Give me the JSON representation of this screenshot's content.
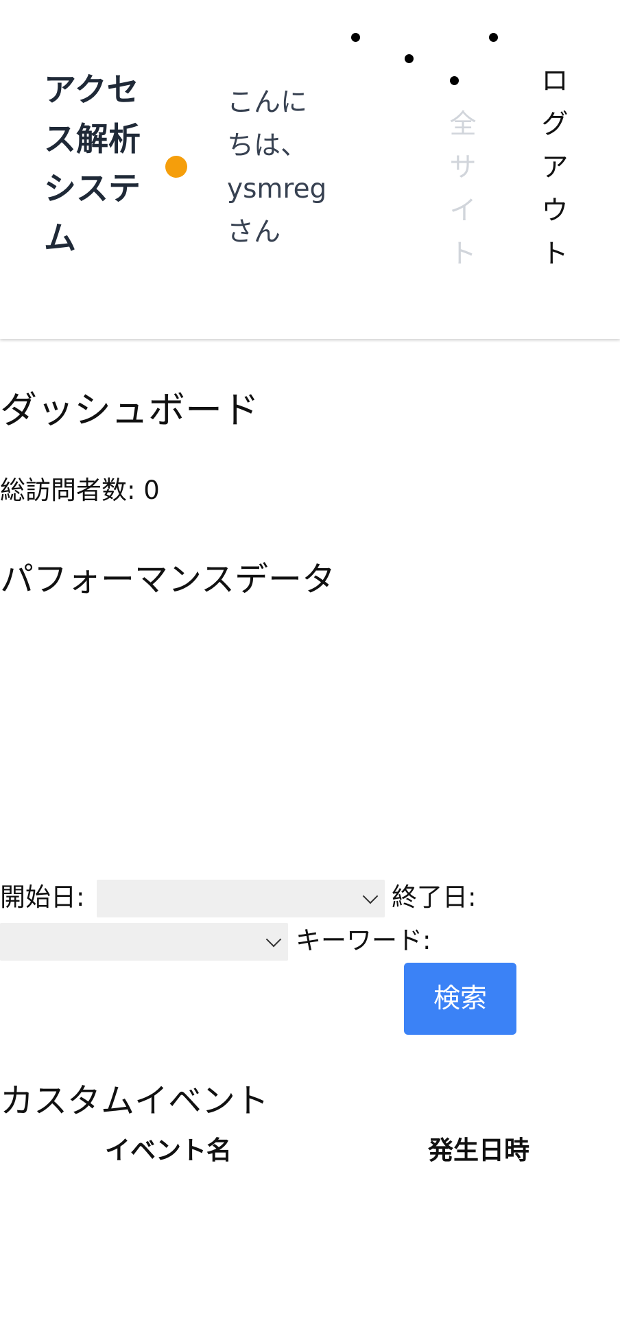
{
  "header": {
    "brand": "アクセス解析システム",
    "greeting": "こんにちは、ysmregさん",
    "nav": {
      "all_sites": "全サイト",
      "logout": "ログアウト"
    },
    "brand_dot_color": "#f59e0b"
  },
  "main": {
    "dashboard_title": "ダッシュボード",
    "total_visitors": "総訪問者数: 0",
    "performance_title": "パフォーマンスデータ",
    "filters": {
      "start_label": "開始日:",
      "start_value": "",
      "end_label": "終了日:",
      "end_value": "",
      "keyword_label": "キーワード:",
      "search_button": "検索"
    },
    "custom_events": {
      "title": "カスタムイベント",
      "columns": [
        "イベント名",
        "発生日時"
      ]
    }
  },
  "colors": {
    "primary": "#3b82f6",
    "accent": "#f59e0b",
    "muted_nav": "#d1d5db"
  }
}
